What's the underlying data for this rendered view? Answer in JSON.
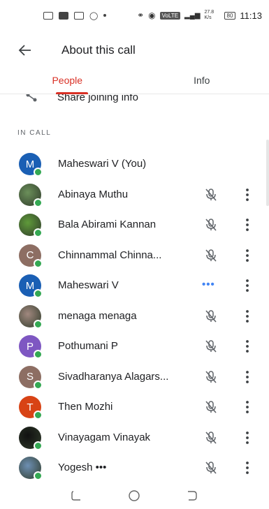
{
  "status_bar": {
    "badge": "VoLTE",
    "net": "27.8 K/s",
    "battery": "80",
    "time": "11:13"
  },
  "app_bar": {
    "title": "About this call",
    "back_icon": "arrow-left-icon"
  },
  "tabs": [
    {
      "label": "People",
      "active": true
    },
    {
      "label": "Info",
      "active": false
    }
  ],
  "share": {
    "label": "Share joining info"
  },
  "section": {
    "label": "IN CALL"
  },
  "participants": [
    {
      "name": "Maheswari V (You)",
      "initial": "M",
      "color": "#1a5fb4",
      "photo": false,
      "status": "none"
    },
    {
      "name": "Abinaya Muthu",
      "initial": "",
      "color": "#6b8f5a",
      "photo": true,
      "status": "muted"
    },
    {
      "name": "Bala Abirami Kannan",
      "initial": "",
      "color": "#5f9a3a",
      "photo": true,
      "status": "muted"
    },
    {
      "name": "Chinnammal Chinna...",
      "initial": "C",
      "color": "#8d6e63",
      "photo": false,
      "status": "muted"
    },
    {
      "name": "Maheswari V",
      "initial": "M",
      "color": "#1a5fb4",
      "photo": false,
      "status": "speaking"
    },
    {
      "name": "menaga menaga",
      "initial": "",
      "color": "#a1887f",
      "photo": true,
      "status": "muted"
    },
    {
      "name": "Pothumani P",
      "initial": "P",
      "color": "#7e57c2",
      "photo": false,
      "status": "muted"
    },
    {
      "name": "Sivadharanya Alagars...",
      "initial": "S",
      "color": "#8d6e63",
      "photo": false,
      "status": "muted"
    },
    {
      "name": "Then Mozhi",
      "initial": "T",
      "color": "#d84315",
      "photo": false,
      "status": "muted"
    },
    {
      "name": "Vinayagam Vinayak",
      "initial": "",
      "color": "#111111",
      "photo": true,
      "status": "muted"
    },
    {
      "name": "Yogesh •••",
      "initial": "",
      "color": "#6d8fb3",
      "photo": true,
      "status": "muted"
    }
  ],
  "nav_bar": {
    "recents_icon": "recents-icon",
    "home_icon": "home-icon",
    "back_icon": "back-nav-icon"
  }
}
